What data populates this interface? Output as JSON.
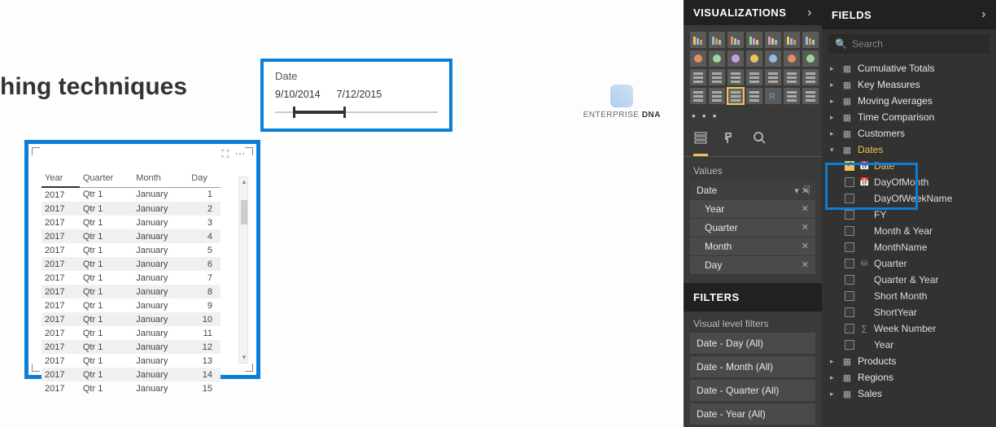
{
  "canvas": {
    "title": "hing techniques",
    "logo_brand": "ENTERPRISE",
    "logo_accent": "DNA"
  },
  "slicer": {
    "label": "Date",
    "start": "9/10/2014",
    "end": "7/12/2015"
  },
  "table": {
    "headers": [
      "Year",
      "Quarter",
      "Month",
      "Day"
    ],
    "rows": [
      [
        "2017",
        "Qtr 1",
        "January",
        "1"
      ],
      [
        "2017",
        "Qtr 1",
        "January",
        "2"
      ],
      [
        "2017",
        "Qtr 1",
        "January",
        "3"
      ],
      [
        "2017",
        "Qtr 1",
        "January",
        "4"
      ],
      [
        "2017",
        "Qtr 1",
        "January",
        "5"
      ],
      [
        "2017",
        "Qtr 1",
        "January",
        "6"
      ],
      [
        "2017",
        "Qtr 1",
        "January",
        "7"
      ],
      [
        "2017",
        "Qtr 1",
        "January",
        "8"
      ],
      [
        "2017",
        "Qtr 1",
        "January",
        "9"
      ],
      [
        "2017",
        "Qtr 1",
        "January",
        "10"
      ],
      [
        "2017",
        "Qtr 1",
        "January",
        "11"
      ],
      [
        "2017",
        "Qtr 1",
        "January",
        "12"
      ],
      [
        "2017",
        "Qtr 1",
        "January",
        "13"
      ],
      [
        "2017",
        "Qtr 1",
        "January",
        "14"
      ],
      [
        "2017",
        "Qtr 1",
        "January",
        "15"
      ]
    ]
  },
  "viz_panel": {
    "title": "VISUALIZATIONS",
    "values_label": "Values",
    "well_head": "Date",
    "well_items": [
      "Year",
      "Quarter",
      "Month",
      "Day"
    ],
    "filters_title": "FILTERS",
    "filters_section": "Visual level filters",
    "filters": [
      "Date - Day (All)",
      "Date - Month (All)",
      "Date - Quarter (All)",
      "Date - Year (All)"
    ]
  },
  "fields_panel": {
    "title": "FIELDS",
    "search_placeholder": "Search",
    "tables": [
      {
        "name": "Cumulative Totals",
        "icon": "table"
      },
      {
        "name": "Key Measures",
        "icon": "table"
      },
      {
        "name": "Moving Averages",
        "icon": "table"
      },
      {
        "name": "Time Comparison",
        "icon": "table"
      },
      {
        "name": "Customers",
        "icon": "table"
      }
    ],
    "dates_table": "Dates",
    "date_fields": [
      {
        "name": "Date",
        "checked": true,
        "icon": "cal"
      },
      {
        "name": "DayOfMonth",
        "checked": false,
        "icon": "cal",
        "clipped": true
      },
      {
        "name": "DayOfWeekName",
        "checked": false,
        "icon": ""
      },
      {
        "name": "FY",
        "checked": false,
        "icon": ""
      },
      {
        "name": "Month & Year",
        "checked": false,
        "icon": ""
      },
      {
        "name": "MonthName",
        "checked": false,
        "icon": ""
      },
      {
        "name": "Quarter",
        "checked": false,
        "icon": "hier"
      },
      {
        "name": "Quarter & Year",
        "checked": false,
        "icon": ""
      },
      {
        "name": "Short Month",
        "checked": false,
        "icon": ""
      },
      {
        "name": "ShortYear",
        "checked": false,
        "icon": ""
      },
      {
        "name": "Week Number",
        "checked": false,
        "icon": "sum"
      },
      {
        "name": "Year",
        "checked": false,
        "icon": ""
      }
    ],
    "tables_after": [
      {
        "name": "Products",
        "icon": "table"
      },
      {
        "name": "Regions",
        "icon": "table"
      },
      {
        "name": "Sales",
        "icon": "table"
      }
    ]
  }
}
